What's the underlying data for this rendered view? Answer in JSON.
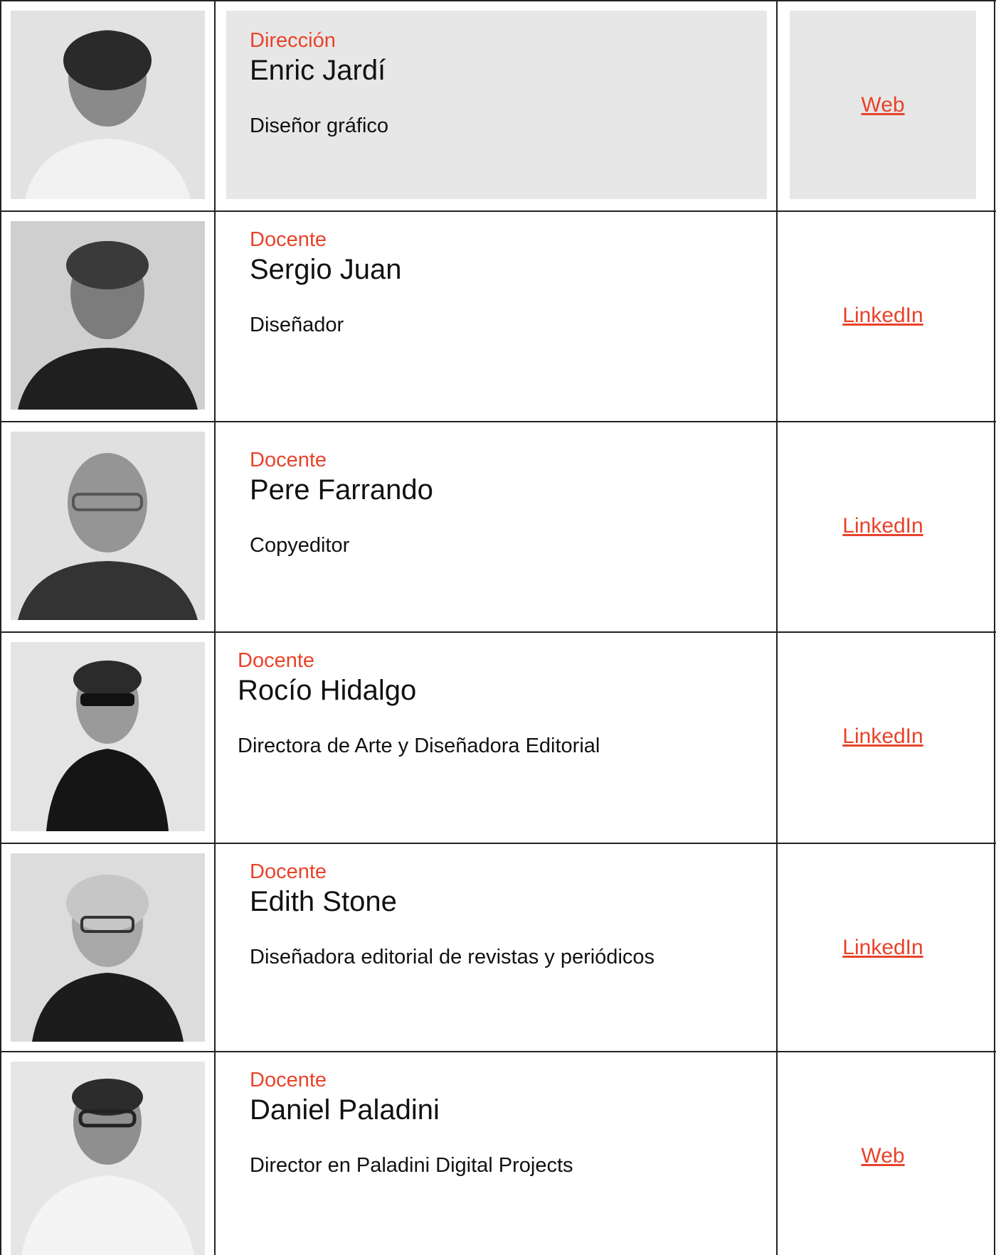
{
  "accent_color": "#e8432a",
  "people": [
    {
      "role": "Dirección",
      "name": "Enric Jardí",
      "description": "Diseñor gráfico",
      "link_label": "Web",
      "photo_icon": "portrait-photo"
    },
    {
      "role": "Docente",
      "name": "Sergio Juan",
      "description": "Diseñador",
      "link_label": "LinkedIn",
      "photo_icon": "portrait-photo"
    },
    {
      "role": "Docente",
      "name": "Pere Farrando",
      "description": "Copyeditor",
      "link_label": "LinkedIn",
      "photo_icon": "portrait-photo"
    },
    {
      "role": "Docente",
      "name": "Rocío Hidalgo",
      "description": "Directora de Arte y Diseñadora Editorial",
      "link_label": "LinkedIn",
      "photo_icon": "portrait-photo"
    },
    {
      "role": "Docente",
      "name": "Edith Stone",
      "description": "Diseñadora editorial de revistas y periódicos",
      "link_label": "LinkedIn",
      "photo_icon": "portrait-photo"
    },
    {
      "role": "Docente",
      "name": "Daniel Paladini",
      "description": "Director en Paladini Digital Projects",
      "link_label": "Web",
      "photo_icon": "portrait-photo"
    }
  ]
}
